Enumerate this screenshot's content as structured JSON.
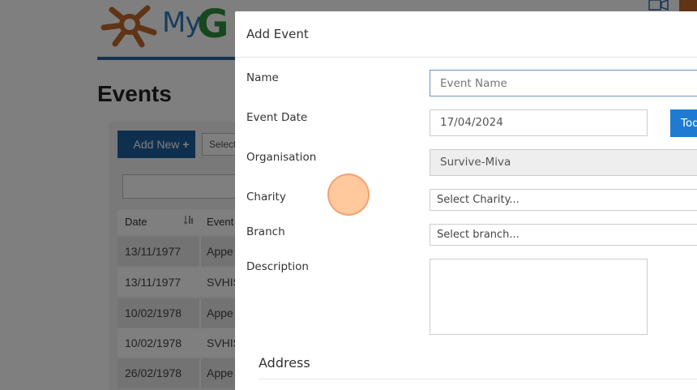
{
  "background": {
    "logo_text": "My",
    "logo_g": "G",
    "page_title": "Events",
    "add_new_label": "Add New",
    "add_new_icon": "plus-icon",
    "select_placeholder": "Select",
    "table": {
      "headers": [
        "Date",
        "Event"
      ],
      "rows": [
        {
          "date": "13/11/1977",
          "event": "Appe"
        },
        {
          "date": "13/11/1977",
          "event": "SVHIS"
        },
        {
          "date": "10/02/1978",
          "event": "Appe"
        },
        {
          "date": "10/02/1978",
          "event": "SVHIS"
        },
        {
          "date": "26/02/1978",
          "event": "Appe"
        }
      ]
    }
  },
  "modal": {
    "title": "Add Event",
    "fields": {
      "name": {
        "label": "Name",
        "placeholder": "Event Name"
      },
      "event_date": {
        "label": "Event Date",
        "value": "17/04/2024",
        "button": "Toda"
      },
      "organisation": {
        "label": "Organisation",
        "value": "Survive-Miva"
      },
      "charity": {
        "label": "Charity",
        "value": "Select Charity..."
      },
      "branch": {
        "label": "Branch",
        "value": "Select branch..."
      },
      "description": {
        "label": "Description",
        "value": ""
      }
    },
    "address_title": "Address"
  },
  "colors": {
    "primary": "#1f5f9e",
    "today_button": "#1f7bd1",
    "overlay": "rgba(0,0,0,0.5)",
    "cursor": "#ffbe8c"
  }
}
